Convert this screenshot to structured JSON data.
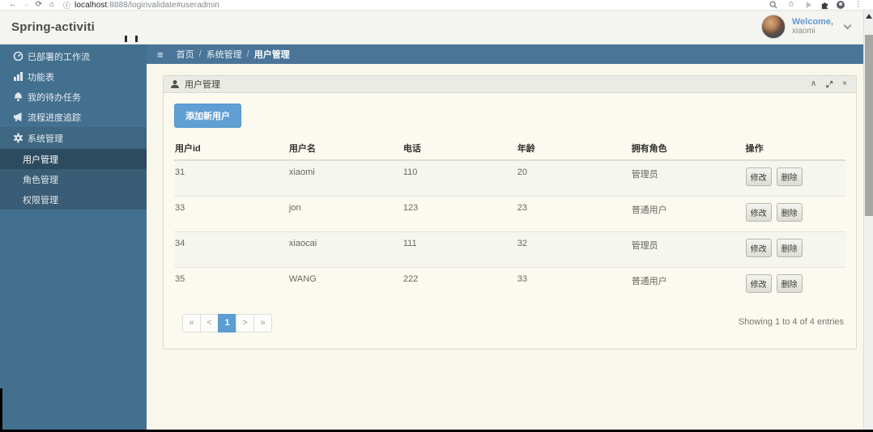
{
  "browser": {
    "icons": {
      "back": "←",
      "forward": "→",
      "reload": "⟳",
      "home": "⌂",
      "info": "ⓘ",
      "star": "☆",
      "menu_dots": "⋮"
    },
    "url_host": "localhost",
    "url_rest": ":8888/loginvalidate#useradmin"
  },
  "app": {
    "brand": "Spring-activiti",
    "welcome": "Welcome,",
    "username": "xiaomi"
  },
  "sidebar": {
    "items": [
      {
        "label": "已部署的工作流"
      },
      {
        "label": "功能表"
      },
      {
        "label": "我的待办任务"
      },
      {
        "label": "流程进度追踪"
      },
      {
        "label": "系统管理"
      }
    ],
    "subitems": [
      {
        "label": "用户管理"
      },
      {
        "label": "角色管理"
      },
      {
        "label": "权限管理"
      }
    ]
  },
  "breadcrumb": {
    "hamburger": "≡",
    "home": "首页",
    "sep": "/",
    "section": "系统管理",
    "current": "用户管理"
  },
  "panel": {
    "title": "用户管理",
    "collapse_icon": "∧",
    "close_icon": "×",
    "add_button": "添加新用户"
  },
  "table": {
    "headers": [
      "用户id",
      "用户名",
      "电话",
      "年龄",
      "拥有角色",
      "操作"
    ],
    "rows": [
      {
        "id": "31",
        "name": "xiaomi",
        "phone": "110",
        "age": "20",
        "role": "管理员"
      },
      {
        "id": "33",
        "name": "jon",
        "phone": "123",
        "age": "23",
        "role": "普通用户"
      },
      {
        "id": "34",
        "name": "xiaocai",
        "phone": "111",
        "age": "32",
        "role": "管理员"
      },
      {
        "id": "35",
        "name": "WANG",
        "phone": "222",
        "age": "33",
        "role": "普通用户"
      }
    ],
    "edit_label": "修改",
    "delete_label": "删除"
  },
  "pagination": {
    "first": "«",
    "prev": "<",
    "page": "1",
    "next": ">",
    "last": "»",
    "info": "Showing 1 to 4 of 4 entries"
  },
  "colors": {
    "accent": "#5b9dd3",
    "sidebar": "#44708f",
    "sidebar_active": "#2d4b5f",
    "breadcrumb_bar": "#4a7598",
    "main_bg": "#f9f7ec"
  }
}
